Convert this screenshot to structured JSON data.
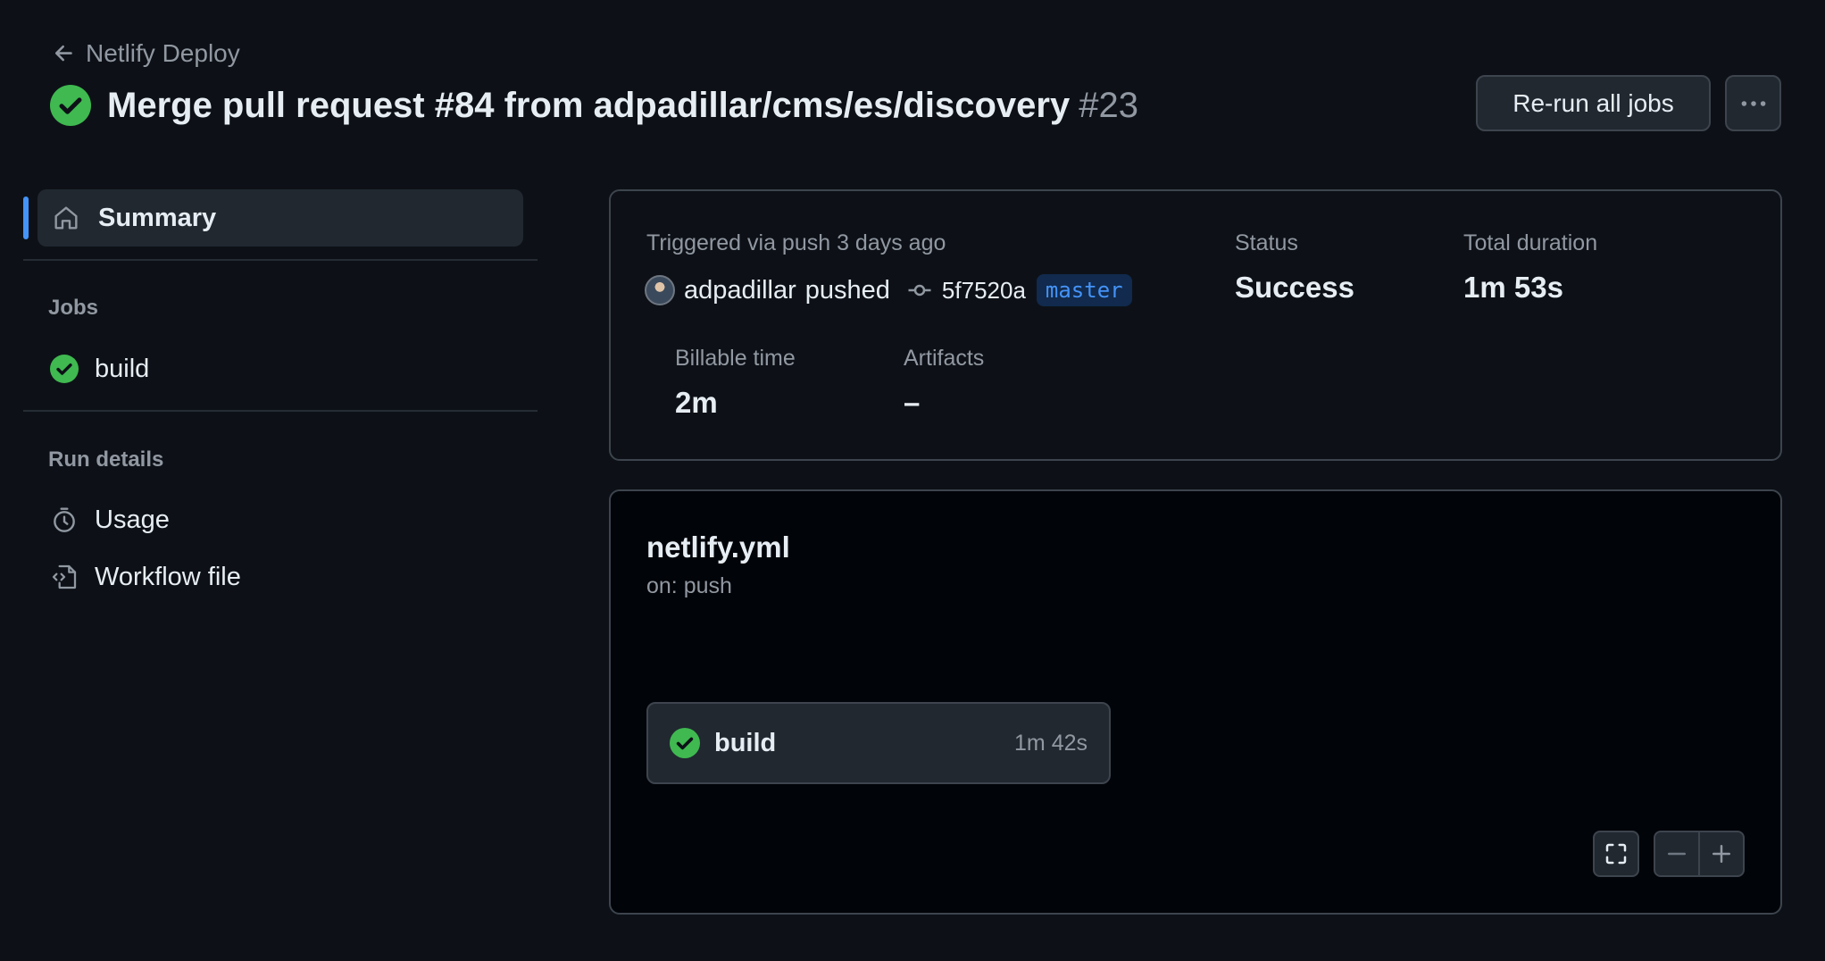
{
  "header": {
    "back_label": "Netlify Deploy",
    "run_title": "Merge pull request #84 from adpadillar/cms/es/discovery",
    "run_number": "#23",
    "rerun_label": "Re-run all jobs"
  },
  "sidebar": {
    "summary_label": "Summary",
    "jobs_heading": "Jobs",
    "jobs": [
      {
        "label": "build",
        "status": "success"
      }
    ],
    "run_details_heading": "Run details",
    "run_details": [
      {
        "label": "Usage",
        "icon": "stopwatch-icon"
      },
      {
        "label": "Workflow file",
        "icon": "file-code-icon"
      }
    ]
  },
  "summary": {
    "triggered_text": "Triggered via push 3 days ago",
    "actor": "adpadillar",
    "action": "pushed",
    "commit_sha": "5f7520a",
    "branch": "master",
    "status_label": "Status",
    "status_value": "Success",
    "duration_label": "Total duration",
    "duration_value": "1m 53s",
    "billable_label": "Billable time",
    "billable_value": "2m",
    "artifacts_label": "Artifacts",
    "artifacts_value": "–"
  },
  "graph": {
    "workflow_file": "netlify.yml",
    "trigger": "on: push",
    "job": {
      "name": "build",
      "duration": "1m 42s"
    }
  },
  "colors": {
    "background": "#0d1117",
    "success": "#3fb950",
    "accent": "#4493f8",
    "muted_text": "#9198a1"
  }
}
